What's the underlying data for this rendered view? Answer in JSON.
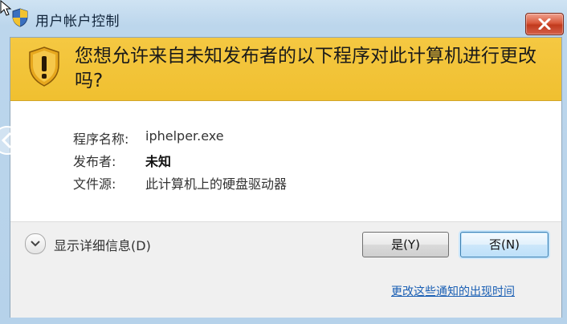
{
  "window": {
    "title": "用户帐户控制",
    "icons": {
      "title": "uac-shield-icon",
      "close": "close-icon"
    }
  },
  "banner": {
    "question": "您想允许来自未知发布者的以下程序对此计算机进行更改吗?",
    "icon": "warning-shield-icon",
    "color": "#f0c030"
  },
  "details": {
    "program_label": "程序名称:",
    "program_value": "iphelper.exe",
    "publisher_label": "发布者:",
    "publisher_value": "未知",
    "origin_label": "文件源:",
    "origin_value": "此计算机上的硬盘驱动器"
  },
  "footer": {
    "show_details_label": "显示详细信息(D)",
    "yes_label": "是(Y)",
    "no_label": "否(N)",
    "settings_link": "更改这些通知的出现时间"
  },
  "colors": {
    "close": "#c13a1d",
    "link": "#1a5fb4",
    "default_button_border": "#3c7fb1"
  }
}
